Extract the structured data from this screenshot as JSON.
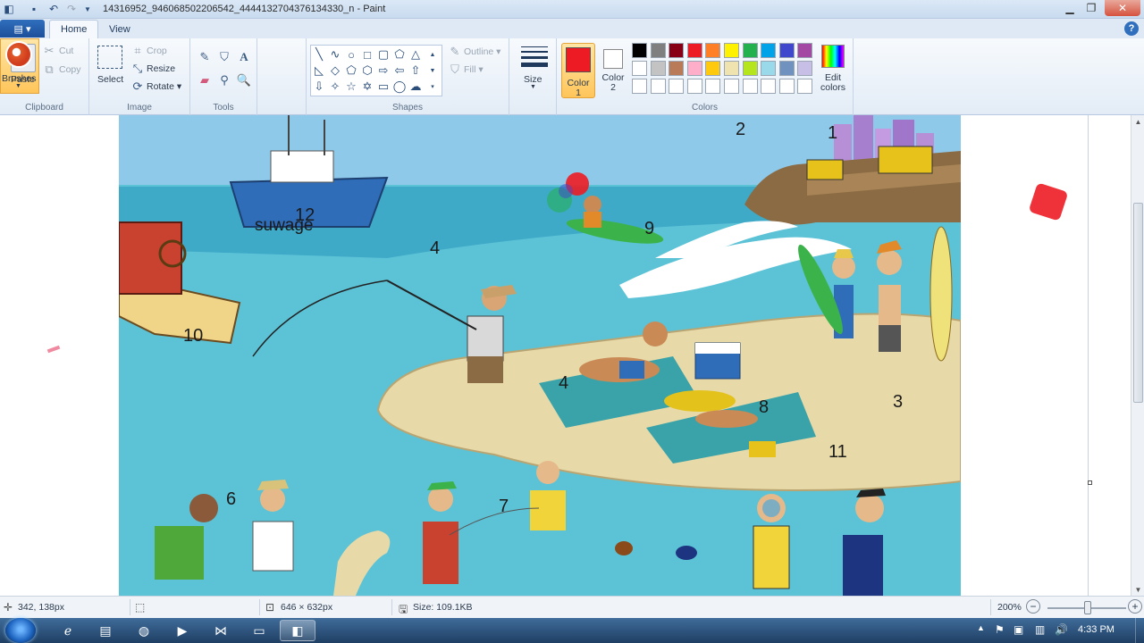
{
  "window": {
    "title": "14316952_946068502206542_4444132704376134330_n - Paint"
  },
  "tabs": {
    "file_label": "▤ ▾",
    "home": "Home",
    "view": "View",
    "help": "?"
  },
  "ribbon": {
    "clipboard": {
      "group": "Clipboard",
      "paste": "Paste",
      "cut": "Cut",
      "copy": "Copy"
    },
    "image": {
      "group": "Image",
      "select": "Select",
      "crop": "Crop",
      "resize": "Resize",
      "rotate": "Rotate ▾"
    },
    "tools": {
      "group": "Tools"
    },
    "brushes": {
      "label": "Brushes"
    },
    "shapes": {
      "group": "Shapes",
      "outline": "Outline ▾",
      "fill": "Fill ▾"
    },
    "size": {
      "label": "Size"
    },
    "colors": {
      "group": "Colors",
      "color1": "Color 1",
      "color2": "Color 2",
      "edit": "Edit colors",
      "color1_value": "#ed1c24",
      "color2_value": "#ffffff",
      "palette": [
        "#000000",
        "#7f7f7f",
        "#880015",
        "#ed1c24",
        "#ff7f27",
        "#fff200",
        "#22b14c",
        "#00a2e8",
        "#3f48cc",
        "#a349a4",
        "#ffffff",
        "#c3c3c3",
        "#b97a57",
        "#ffaec9",
        "#ffc90e",
        "#efe4b0",
        "#b5e61d",
        "#99d9ea",
        "#7092be",
        "#c8bfe7",
        "#ffffff",
        "#ffffff",
        "#ffffff",
        "#ffffff",
        "#ffffff",
        "#ffffff",
        "#ffffff",
        "#ffffff",
        "#ffffff",
        "#ffffff"
      ]
    }
  },
  "canvas": {
    "labels": [
      "2",
      "1",
      "12",
      "suwage",
      "4",
      "9",
      "10",
      "4",
      "8",
      "3",
      "11",
      "6",
      "7"
    ]
  },
  "status": {
    "cursor": "342, 138px",
    "selection": "",
    "dimensions": "646 × 632px",
    "size": "Size: 109.1KB",
    "zoom": "200%",
    "zoom_minus": "−",
    "zoom_plus": "+"
  },
  "taskbar": {
    "clock": "4:33 PM"
  }
}
